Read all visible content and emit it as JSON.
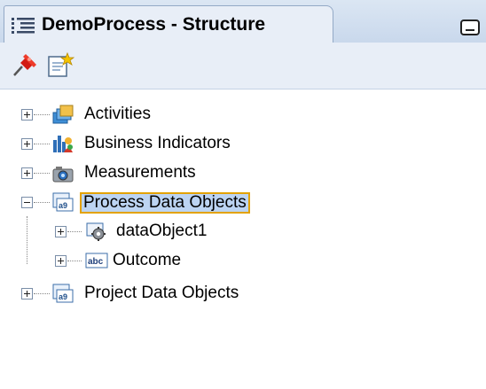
{
  "panel": {
    "title": "DemoProcess - Structure"
  },
  "toolbar": {
    "pin_icon": "pin-icon",
    "edit_icon": "edit-icon"
  },
  "tree": {
    "items": [
      {
        "label": "Activities",
        "icon": "activities-icon",
        "expanded": false,
        "level": 0
      },
      {
        "label": "Business Indicators",
        "icon": "business-indicators-icon",
        "expanded": false,
        "level": 0
      },
      {
        "label": "Measurements",
        "icon": "measurements-icon",
        "expanded": false,
        "level": 0
      },
      {
        "label": "Process Data Objects",
        "icon": "data-objects-icon",
        "expanded": true,
        "selected": true,
        "level": 0
      },
      {
        "label": "dataObject1",
        "icon": "gear-data-icon",
        "expanded": false,
        "level": 1
      },
      {
        "label": "Outcome",
        "icon": "abc-icon",
        "expanded": false,
        "level": 1
      },
      {
        "label": "Project Data Objects",
        "icon": "data-objects-icon",
        "expanded": false,
        "level": 0
      }
    ]
  },
  "colors": {
    "selection_fill": "#bcd4f2",
    "selection_border": "#e3a200",
    "header_bg": "#dbe6f3"
  }
}
